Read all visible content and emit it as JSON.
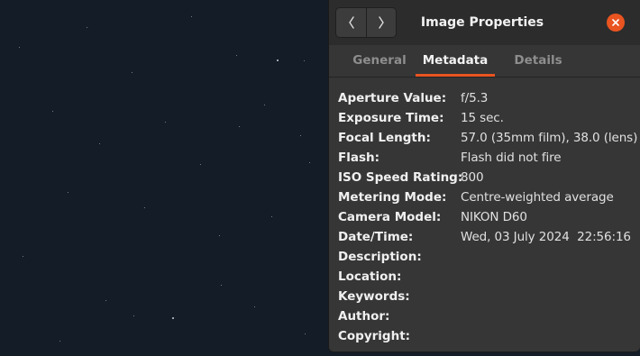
{
  "window": {
    "title": "Image Properties"
  },
  "icons": {
    "back": "chevron-left-icon",
    "forward": "chevron-right-icon",
    "close": "close-icon"
  },
  "colors": {
    "accent": "#e95420",
    "headerbar": "#2c2c2c",
    "dialog_bg": "#363636",
    "desktop_bg": "#141c27"
  },
  "tabs": [
    {
      "label": "General",
      "active": false
    },
    {
      "label": "Metadata",
      "active": true
    },
    {
      "label": "Details",
      "active": false
    }
  ],
  "metadata": [
    {
      "key": "Aperture Value:",
      "value": "f/5.3"
    },
    {
      "key": "Exposure Time:",
      "value": "15 sec."
    },
    {
      "key": "Focal Length:",
      "value": "57.0 (35mm film), 38.0 (lens)"
    },
    {
      "key": "Flash:",
      "value": "Flash did not fire"
    },
    {
      "key": "ISO Speed Rating:",
      "value": "800"
    },
    {
      "key": "Metering Mode:",
      "value": "Centre-weighted average"
    },
    {
      "key": "Camera Model:",
      "value": "NIKON D60"
    },
    {
      "key": "Date/Time:",
      "value": "Wed, 03 July 2024  22:56:16"
    },
    {
      "key": "Description:",
      "value": ""
    },
    {
      "key": "Location:",
      "value": ""
    },
    {
      "key": "Keywords:",
      "value": ""
    },
    {
      "key": "Author:",
      "value": ""
    },
    {
      "key": "Copyright:",
      "value": ""
    }
  ]
}
